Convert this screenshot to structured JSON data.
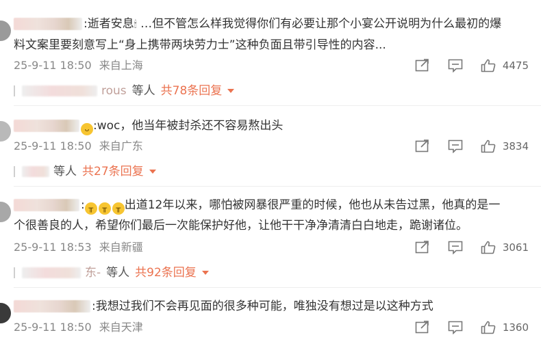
{
  "comments": [
    {
      "text": ":逝者安息🕯 …但不管怎么样我觉得你们有必要让那个小宴公开说明为什么最初的爆料文案里要刻意写上“身上携带两块劳力士”这种负面且带引导性的内容...",
      "line1": ":逝者安息",
      "candle": "🕯",
      "line1b": " …但不管怎么样我觉得你们有必要让那个小宴公开说明为什么最初的爆",
      "line2": "料文案里要刻意写上“身上携带两块劳力士”这种负面且带引导性的内容...",
      "time": "25-9-11 18:50",
      "location": "来自上海",
      "likes": "4475",
      "reply_name_tail": "rous",
      "reply_etc": "等人",
      "reply_total": "共78条回复"
    },
    {
      "line1": ":woc，他当年被封杀还不容易熬出头",
      "time": "25-9-11 18:50",
      "location": "来自广东",
      "likes": "3834",
      "reply_etc": "等人",
      "reply_total": "共27条回复"
    },
    {
      "line1": ":😭😭😭出道12年以来，哪怕被网暴很严重的时候，他也从未告过黑，他真的是一",
      "line1_emoji": "😭",
      "line1_prefix": ":",
      "line1_rest": "出道12年以来，哪怕被网暴很严重的时候，他也从未告过黑，他真的是一",
      "line2": "个很善良的人，希望你们最后一次能保护好他，让他干干净净清清白白地走，跪谢诸位。",
      "time": "25-9-11 18:53",
      "location": "来自新疆",
      "likes": "3061",
      "reply_name_tail": "东-",
      "reply_etc": "等人",
      "reply_total": "共92条回复"
    },
    {
      "line1": ":我想过我们不会再见面的很多种可能，唯独没有想过是以这种方式",
      "time": "25-9-11 18:50",
      "location": "来自天津",
      "likes": "1360"
    }
  ],
  "icons": [
    "share-icon",
    "comment-icon",
    "like-icon",
    "expand-caret-icon"
  ],
  "colors": {
    "accent": "#eb7350",
    "meta": "#888888",
    "text": "#333333"
  }
}
